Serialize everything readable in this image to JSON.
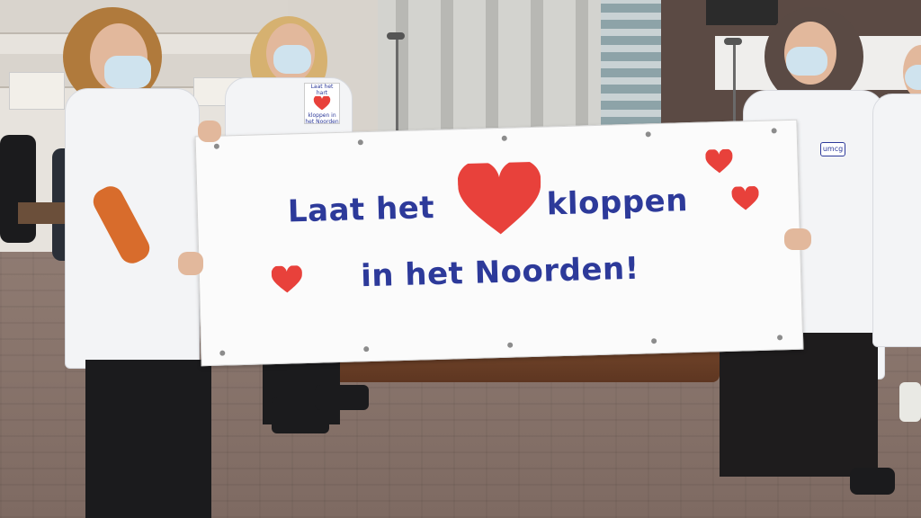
{
  "photo": {
    "banner": {
      "line1_part1": "Laat het",
      "line1_part2": "kloppen",
      "line2": "in het Noorden!",
      "text_color": "#2d3a9a",
      "heart_color": "#e8413b"
    },
    "flyer": {
      "line1": "Laat het hart",
      "line2": "kloppen in",
      "line3": "het Noorden"
    },
    "badge": "umcg"
  }
}
